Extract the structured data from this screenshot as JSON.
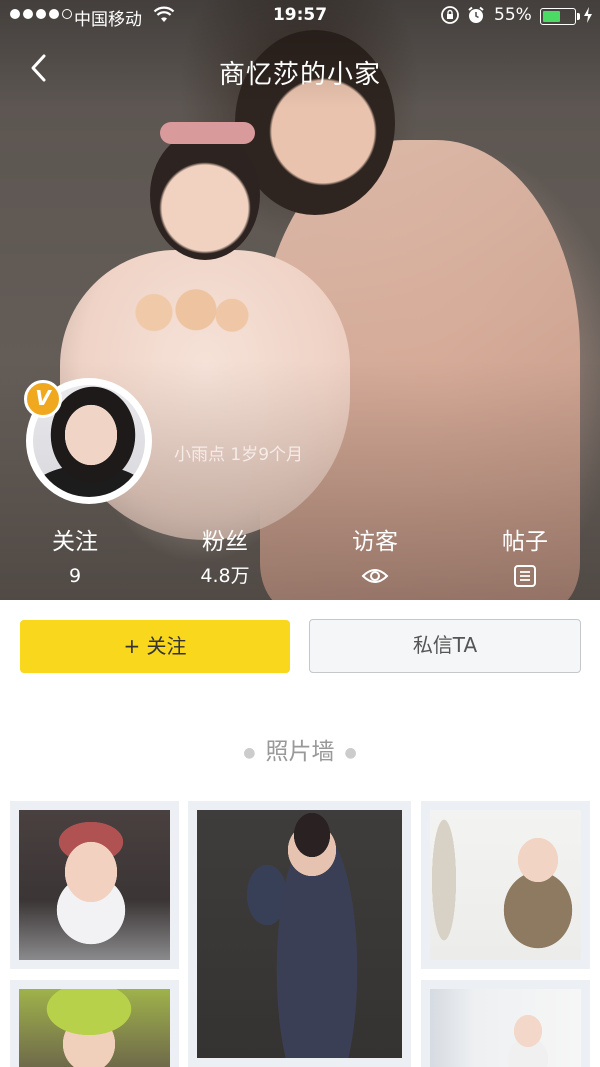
{
  "status_bar": {
    "carrier": "中国移动",
    "time": "19:57",
    "battery_percent": "55%",
    "battery_level": 0.55,
    "signal_bars_filled": 4,
    "signal_bars_total": 5,
    "icons": [
      "wifi-icon",
      "rotation-lock-icon",
      "alarm-icon",
      "battery-icon",
      "charging-icon"
    ]
  },
  "nav": {
    "title": "商忆莎的小家",
    "back_icon": "chevron-left-icon"
  },
  "profile": {
    "vip_badge": "V",
    "baby_info": "小雨点 1岁9个月"
  },
  "stats": [
    {
      "label": "关注",
      "value": "9"
    },
    {
      "label": "粉丝",
      "value": "4.8万"
    },
    {
      "label": "访客",
      "icon": "eye-icon"
    },
    {
      "label": "帖子",
      "icon": "list-icon"
    }
  ],
  "actions": {
    "follow_label": "+ 关注",
    "message_label": "私信TA"
  },
  "photo_wall": {
    "title": "照片墙",
    "photo_count_visible": 5
  },
  "colors": {
    "accent_yellow": "#f9d71c",
    "vip_orange": "#f0a81e",
    "battery_green": "#4cd964"
  }
}
